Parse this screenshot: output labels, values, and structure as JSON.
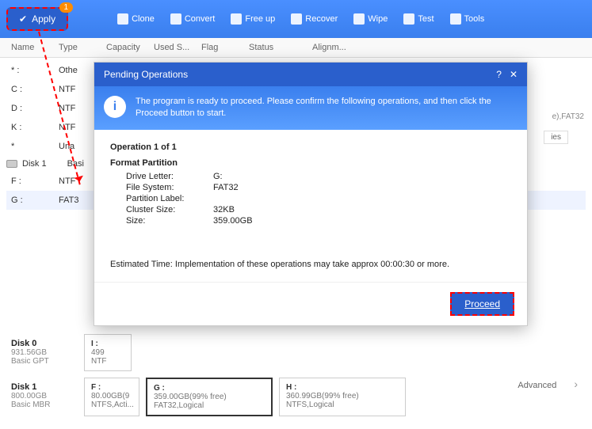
{
  "toolbar": {
    "apply": "Apply",
    "apply_badge": "1",
    "items": [
      "Clone",
      "Convert",
      "Free up",
      "Recover",
      "Wipe",
      "Test",
      "Tools"
    ]
  },
  "table": {
    "headers": [
      "Name",
      "Type",
      "Capacity",
      "Used S...",
      "Flag",
      "Status",
      "Alignm..."
    ]
  },
  "rows": [
    {
      "name": "* :",
      "type": "Othe"
    },
    {
      "name": "C :",
      "type": "NTF"
    },
    {
      "name": "D :",
      "type": "NTF"
    },
    {
      "name": "K :",
      "type": "NTF"
    },
    {
      "name": "*",
      "type": "Una"
    },
    {
      "name": "F :",
      "type": "NTF"
    },
    {
      "name": "G :",
      "type": "FAT3"
    }
  ],
  "disk1_row_label": "Disk 1",
  "disk1_row_type": "Basi",
  "side": {
    "fs": "e),FAT32",
    "btn": "ies"
  },
  "dialog": {
    "title": "Pending Operations",
    "message": "The program is ready to proceed. Please confirm the following operations, and then click the Proceed button to start.",
    "op_count": "Operation 1 of 1",
    "op_name": "Format Partition",
    "fields": {
      "drive_letter_k": "Drive Letter:",
      "drive_letter_v": "G:",
      "file_system_k": "File System:",
      "file_system_v": "FAT32",
      "label_k": "Partition Label:",
      "label_v": "",
      "cluster_k": "Cluster Size:",
      "cluster_v": "32KB",
      "size_k": "Size:",
      "size_v": "359.00GB"
    },
    "estimate": "Estimated Time: Implementation of these operations may take approx 00:00:30 or more.",
    "proceed": "Proceed"
  },
  "disks": [
    {
      "name": "Disk 0",
      "size": "931.56GB",
      "type": "Basic GPT",
      "parts": [
        {
          "n": "I :",
          "d1": "499",
          "d2": "NTF"
        }
      ]
    },
    {
      "name": "Disk 1",
      "size": "800.00GB",
      "type": "Basic MBR",
      "parts": [
        {
          "n": "F :",
          "d1": "80.00GB(9",
          "d2": "NTFS,Acti..."
        },
        {
          "n": "G :",
          "d1": "359.00GB(99% free)",
          "d2": "FAT32,Logical",
          "sel": true
        },
        {
          "n": "H :",
          "d1": "360.99GB(99% free)",
          "d2": "NTFS,Logical"
        }
      ]
    }
  ],
  "advanced": "Advanced"
}
